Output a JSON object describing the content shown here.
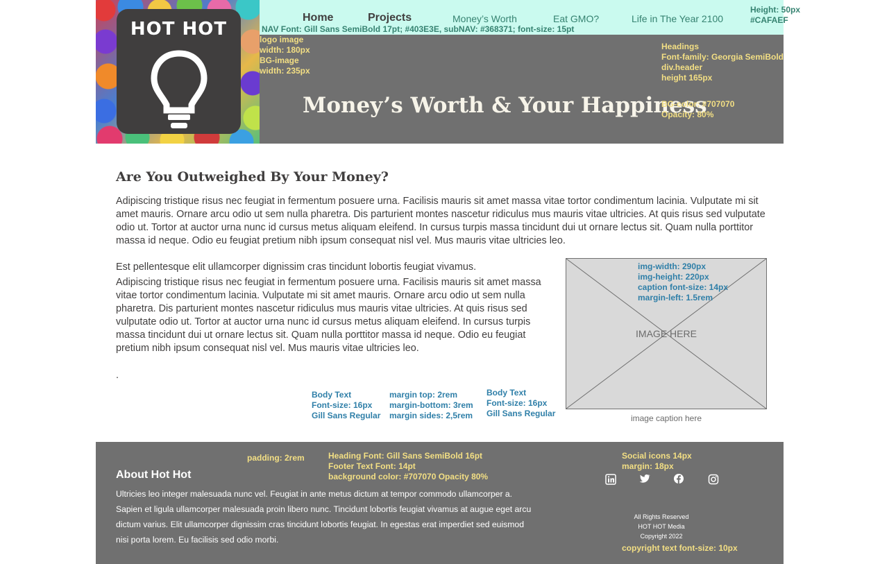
{
  "colors": {
    "header_bg": "#707070",
    "nav_bg": "#CAFAEF",
    "nav_text": "#403E3E",
    "subnav_text": "#368371",
    "annotation_yellow": "#f3df84",
    "annotation_blue": "#2f7fa8"
  },
  "header": {
    "logo_text": "HOT HOT",
    "logo_icon": "lightbulb-icon",
    "hero_title": "Money’s Worth & Your Happiness",
    "nav": {
      "main": [
        "Home",
        "Projects"
      ],
      "sub": [
        "Money’s Worth",
        "Eat GMO?",
        "Life in The Year 2100"
      ]
    },
    "annotations": {
      "nav_height": "Height: 50px",
      "nav_color": "#CAFAEF",
      "nav_font": "NAV Font: Gill Sans SemiBold 17pt; #403E3E, subNAV: #368371; font-size: 15pt",
      "logo_image": "logo image",
      "logo_width": "width: 180px",
      "bg_image": "BG-image",
      "bg_width": "width: 235px",
      "headings": "Headings",
      "headings_font": "Font-family: Georgia SemiBold",
      "div_header": "div.header",
      "header_height": "height 165px",
      "bg_color": "BG-color: #707070",
      "opacity": "Opacity: 80%"
    }
  },
  "main": {
    "heading": "Are You Outweighed By Your Money?",
    "paragraph1": "Adipiscing tristique risus nec feugiat in fermentum posuere urna. Facilisis mauris sit amet massa vitae tortor condimentum lacinia. Vulputate mi sit amet mauris. Ornare arcu odio ut sem nulla pharetra. Dis parturient montes nascetur ridiculus mus mauris vitae ultricies. At quis risus sed vulputate odio ut. Tortor at auctor urna nunc id cursus metus aliquam eleifend. In cursus turpis massa tincidunt dui ut ornare lectus sit. Quam nulla porttitor massa id neque. Odio eu feugiat pretium nibh ipsum consequat nisl vel. Mus mauris vitae ultricies leo.",
    "paragraph2_lead": "Est pellentesque elit ullamcorper dignissim cras tincidunt lobortis feugiat vivamus.",
    "paragraph2": "Adipiscing tristique risus nec feugiat in fermentum posuere urna. Facilisis mauris sit amet massa vitae tortor condimentum lacinia. Vulputate mi sit amet mauris. Ornare arcu odio ut sem nulla pharetra. Dis parturient montes nascetur ridiculus mus mauris vitae ultricies. At quis risus sed vulputate odio ut. Tortor at auctor urna nunc id cursus metus aliquam eleifend. In cursus turpis massa tincidunt dui ut ornare lectus sit. Quam nulla porttitor massa id neque. Odio eu feugiat pretium nibh ipsum consequat nisl vel. Mus mauris vitae ultricies leo.",
    "dot": ".",
    "image_label": "IMAGE HERE",
    "image_caption": "image caption here",
    "annotations": {
      "img_width": "img-width: 290px",
      "img_height": "img-height: 220px",
      "caption_font": "caption font-size: 14px",
      "margin_left": "margin-left: 1.5rem",
      "body_text_1": "Body Text",
      "body_font_size_1": "Font-size: 16px",
      "body_font_1": "Gill Sans Regular",
      "margin_top": "margin top: 2rem",
      "margin_bottom": "margin-bottom: 3rem",
      "margin_sides": "margin sides: 2,5rem",
      "body_text_2": "Body Text",
      "body_font_size_2": "Font-size: 16px",
      "body_font_2": "Gill Sans Regular"
    }
  },
  "footer": {
    "heading": "About Hot Hot",
    "text": "Ultricies leo integer malesuada nunc vel. Feugiat in ante metus dictum at tempor commodo ullamcorper a. Sapien et ligula ullamcorper malesuada proin libero nunc. Tincidunt lobortis feugiat vivamus at augue eget arcu dictum varius. Elit ullamcorper dignissim cras tincidunt lobortis feugiat. In egestas erat imperdiet sed euismod nisi porta lorem. Eu facilisis sed odio morbi.",
    "copyright_lines": [
      "All Rights Reserved",
      "HOT HOT Media",
      "Copyright 2022"
    ],
    "social": [
      "linkedin-icon",
      "twitter-icon",
      "facebook-icon",
      "instagram-icon"
    ],
    "annotations": {
      "padding": "padding: 2rem",
      "heading_font": "Heading Font: Gill Sans SemiBold 16pt",
      "footer_font": "Footer Text Font: 14pt",
      "bg_color": "background color: #707070 Opacity 80%",
      "social_size": "Social icons 14px",
      "social_margin": "margin: 18px",
      "copyright_size": "copyright text font-size: 10px"
    }
  }
}
